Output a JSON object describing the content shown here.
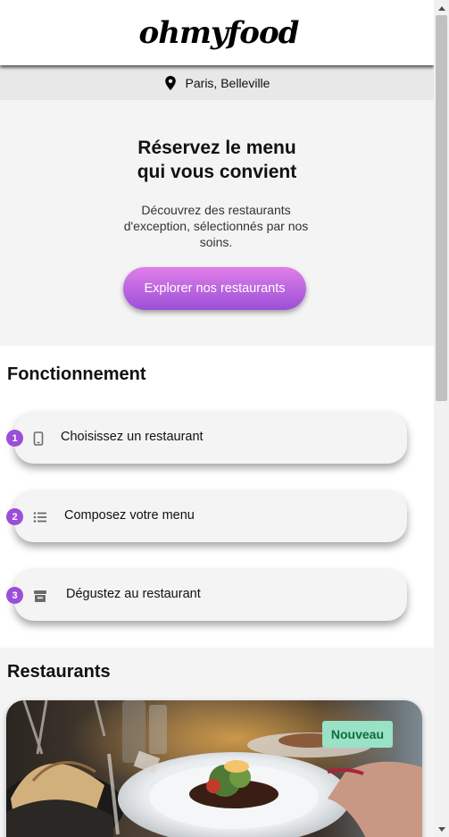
{
  "header": {
    "logo": "ohmyfood"
  },
  "location": {
    "text": "Paris, Belleville",
    "icon": "map-pin-icon"
  },
  "hero": {
    "title_line1": "Réservez le menu",
    "title_line2": "qui vous convient",
    "subtitle": "Découvrez des restaurants d'exception, sélectionnés par nos soins.",
    "cta_label": "Explorer nos restaurants"
  },
  "how": {
    "title": "Fonctionnement",
    "steps": [
      {
        "number": "1",
        "label": "Choisissez un restaurant",
        "icon": "smartphone-icon"
      },
      {
        "number": "2",
        "label": "Composez votre menu",
        "icon": "list-icon"
      },
      {
        "number": "3",
        "label": "Dégustez au restaurant",
        "icon": "store-icon"
      }
    ]
  },
  "restaurants": {
    "title": "Restaurants",
    "cards": [
      {
        "badge": "Nouveau"
      }
    ]
  },
  "colors": {
    "accent": "#9b4fd8",
    "accent_light": "#e07fe8",
    "badge_bg": "#99e2c6",
    "badge_text": "#116b3f"
  }
}
